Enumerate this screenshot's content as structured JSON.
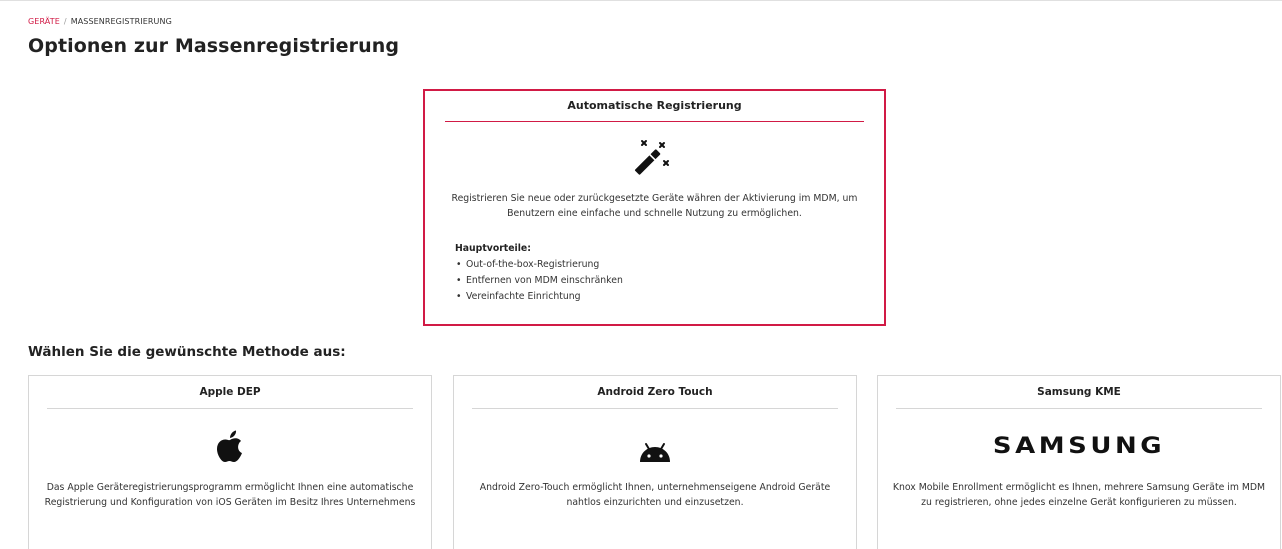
{
  "breadcrumb": {
    "parent": "GERÄTE",
    "separator": "/",
    "current": "MASSENREGISTRIERUNG"
  },
  "page_title": "Optionen zur Massenregistrierung",
  "auto_registration": {
    "title": "Automatische Registrierung",
    "icon": "magic-wand-icon",
    "description": "Registrieren Sie neue oder zurückgesetzte Geräte währen der Aktivierung im MDM, um Benutzern eine einfache und schnelle Nutzung zu ermöglichen.",
    "benefits_title": "Hauptvorteile:",
    "benefits": [
      "Out-of-the-box-Registrierung",
      "Entfernen von MDM einschränken",
      "Vereinfachte Einrichtung"
    ]
  },
  "methods_heading": "Wählen Sie die gewünschte Methode aus:",
  "methods": [
    {
      "title": "Apple DEP",
      "icon": "apple-icon",
      "description": "Das Apple Geräteregistrierungsprogramm ermöglicht Ihnen eine automatische Registrierung und Konfiguration von iOS Geräten im Besitz Ihres Unternehmens"
    },
    {
      "title": "Android Zero Touch",
      "icon": "android-icon",
      "description": "Android Zero-Touch ermöglicht Ihnen, unternehmenseigene Android Geräte nahtlos einzurichten und einzusetzen."
    },
    {
      "title": "Samsung KME",
      "icon": "samsung-logo",
      "logo_text": "SAMSUNG",
      "description": "Knox Mobile Enrollment ermöglicht es Ihnen, mehrere Samsung Geräte im MDM zu registrieren, ohne jedes einzelne Gerät konfigurieren zu müssen."
    }
  ],
  "colors": {
    "accent": "#d11a45",
    "border": "#d6d6d6",
    "text": "#222222"
  }
}
